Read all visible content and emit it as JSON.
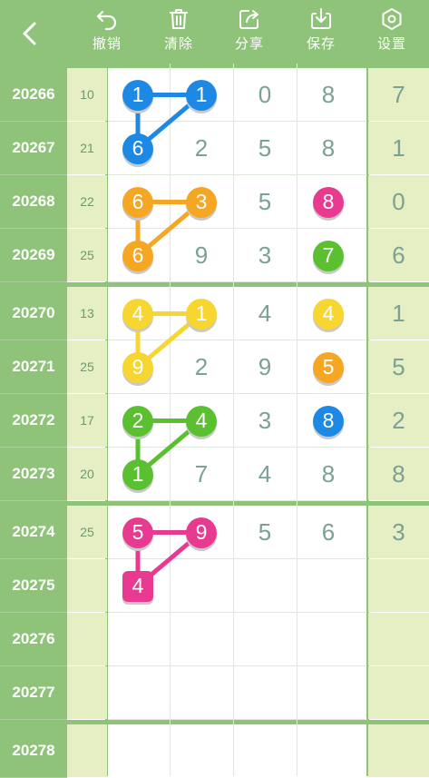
{
  "toolbar": {
    "back_label": "",
    "buttons": [
      {
        "label": "撤销",
        "icon": "undo-icon"
      },
      {
        "label": "清除",
        "icon": "trash-icon"
      },
      {
        "label": "分享",
        "icon": "share-icon"
      },
      {
        "label": "保存",
        "icon": "download-icon"
      },
      {
        "label": "设置",
        "icon": "settings-icon"
      }
    ]
  },
  "colors": {
    "green": "#8fc379",
    "light": "#e5efc3",
    "blue": "#1e88e5",
    "orange": "#f5a623",
    "yellow": "#f8d632",
    "lime": "#5ac02f",
    "pink": "#e83a90",
    "text": "#7ba195"
  },
  "rows": [
    {
      "issue": "20266",
      "sum": "10",
      "cells": [
        "1",
        "1",
        "0",
        "8"
      ],
      "last": "7"
    },
    {
      "issue": "20267",
      "sum": "21",
      "cells": [
        "6",
        "2",
        "5",
        "8"
      ],
      "last": "1"
    },
    {
      "issue": "20268",
      "sum": "22",
      "cells": [
        "6",
        "3",
        "5",
        "8"
      ],
      "last": "0"
    },
    {
      "issue": "20269",
      "sum": "25",
      "cells": [
        "6",
        "9",
        "3",
        "7"
      ],
      "last": "6"
    },
    {
      "issue": "20270",
      "sum": "13",
      "cells": [
        "4",
        "1",
        "4",
        "4"
      ],
      "last": "1"
    },
    {
      "issue": "20271",
      "sum": "25",
      "cells": [
        "9",
        "2",
        "9",
        "5"
      ],
      "last": "5"
    },
    {
      "issue": "20272",
      "sum": "17",
      "cells": [
        "2",
        "4",
        "3",
        "8"
      ],
      "last": "2"
    },
    {
      "issue": "20273",
      "sum": "20",
      "cells": [
        "1",
        "7",
        "4",
        "8"
      ],
      "last": "8"
    },
    {
      "issue": "20274",
      "sum": "25",
      "cells": [
        "5",
        "9",
        "5",
        "6"
      ],
      "last": "3"
    },
    {
      "issue": "20275",
      "sum": "",
      "cells": [
        "4",
        "",
        "",
        ""
      ],
      "last": ""
    },
    {
      "issue": "20276",
      "sum": "",
      "cells": [
        "",
        "",
        "",
        ""
      ],
      "last": ""
    },
    {
      "issue": "20277",
      "sum": "",
      "cells": [
        "",
        "",
        "",
        ""
      ],
      "last": ""
    },
    {
      "issue": "20278",
      "sum": "",
      "cells": [
        "",
        "",
        "",
        ""
      ],
      "last": ""
    }
  ],
  "marks": [
    {
      "r": 0,
      "c": 0,
      "color": "blue"
    },
    {
      "r": 0,
      "c": 1,
      "color": "blue"
    },
    {
      "r": 1,
      "c": 0,
      "color": "blue"
    },
    {
      "r": 2,
      "c": 0,
      "color": "orange"
    },
    {
      "r": 2,
      "c": 1,
      "color": "orange"
    },
    {
      "r": 3,
      "c": 0,
      "color": "orange"
    },
    {
      "r": 2,
      "c": 3,
      "color": "pink"
    },
    {
      "r": 3,
      "c": 3,
      "color": "lime"
    },
    {
      "r": 4,
      "c": 0,
      "color": "yellow"
    },
    {
      "r": 4,
      "c": 1,
      "color": "yellow"
    },
    {
      "r": 5,
      "c": 0,
      "color": "yellow"
    },
    {
      "r": 4,
      "c": 3,
      "color": "yellow"
    },
    {
      "r": 5,
      "c": 3,
      "color": "orange"
    },
    {
      "r": 6,
      "c": 0,
      "color": "lime"
    },
    {
      "r": 6,
      "c": 1,
      "color": "lime"
    },
    {
      "r": 7,
      "c": 0,
      "color": "lime"
    },
    {
      "r": 6,
      "c": 3,
      "color": "blue"
    },
    {
      "r": 8,
      "c": 0,
      "color": "pink"
    },
    {
      "r": 8,
      "c": 1,
      "color": "pink"
    },
    {
      "r": 9,
      "c": 0,
      "color": "pink",
      "square": true
    }
  ],
  "connectors": [
    {
      "color": "blue",
      "path": [
        [
          0,
          0
        ],
        [
          0,
          1
        ],
        [
          1,
          0
        ],
        [
          0,
          0
        ]
      ]
    },
    {
      "color": "orange",
      "path": [
        [
          2,
          0
        ],
        [
          2,
          1
        ],
        [
          3,
          0
        ],
        [
          2,
          0
        ]
      ]
    },
    {
      "color": "yellow",
      "path": [
        [
          4,
          0
        ],
        [
          4,
          1
        ],
        [
          5,
          0
        ],
        [
          4,
          0
        ]
      ]
    },
    {
      "color": "lime",
      "path": [
        [
          6,
          0
        ],
        [
          6,
          1
        ],
        [
          7,
          0
        ],
        [
          6,
          0
        ]
      ]
    },
    {
      "color": "pink",
      "path": [
        [
          8,
          0
        ],
        [
          8,
          1
        ],
        [
          9,
          0
        ],
        [
          8,
          0
        ]
      ]
    }
  ]
}
